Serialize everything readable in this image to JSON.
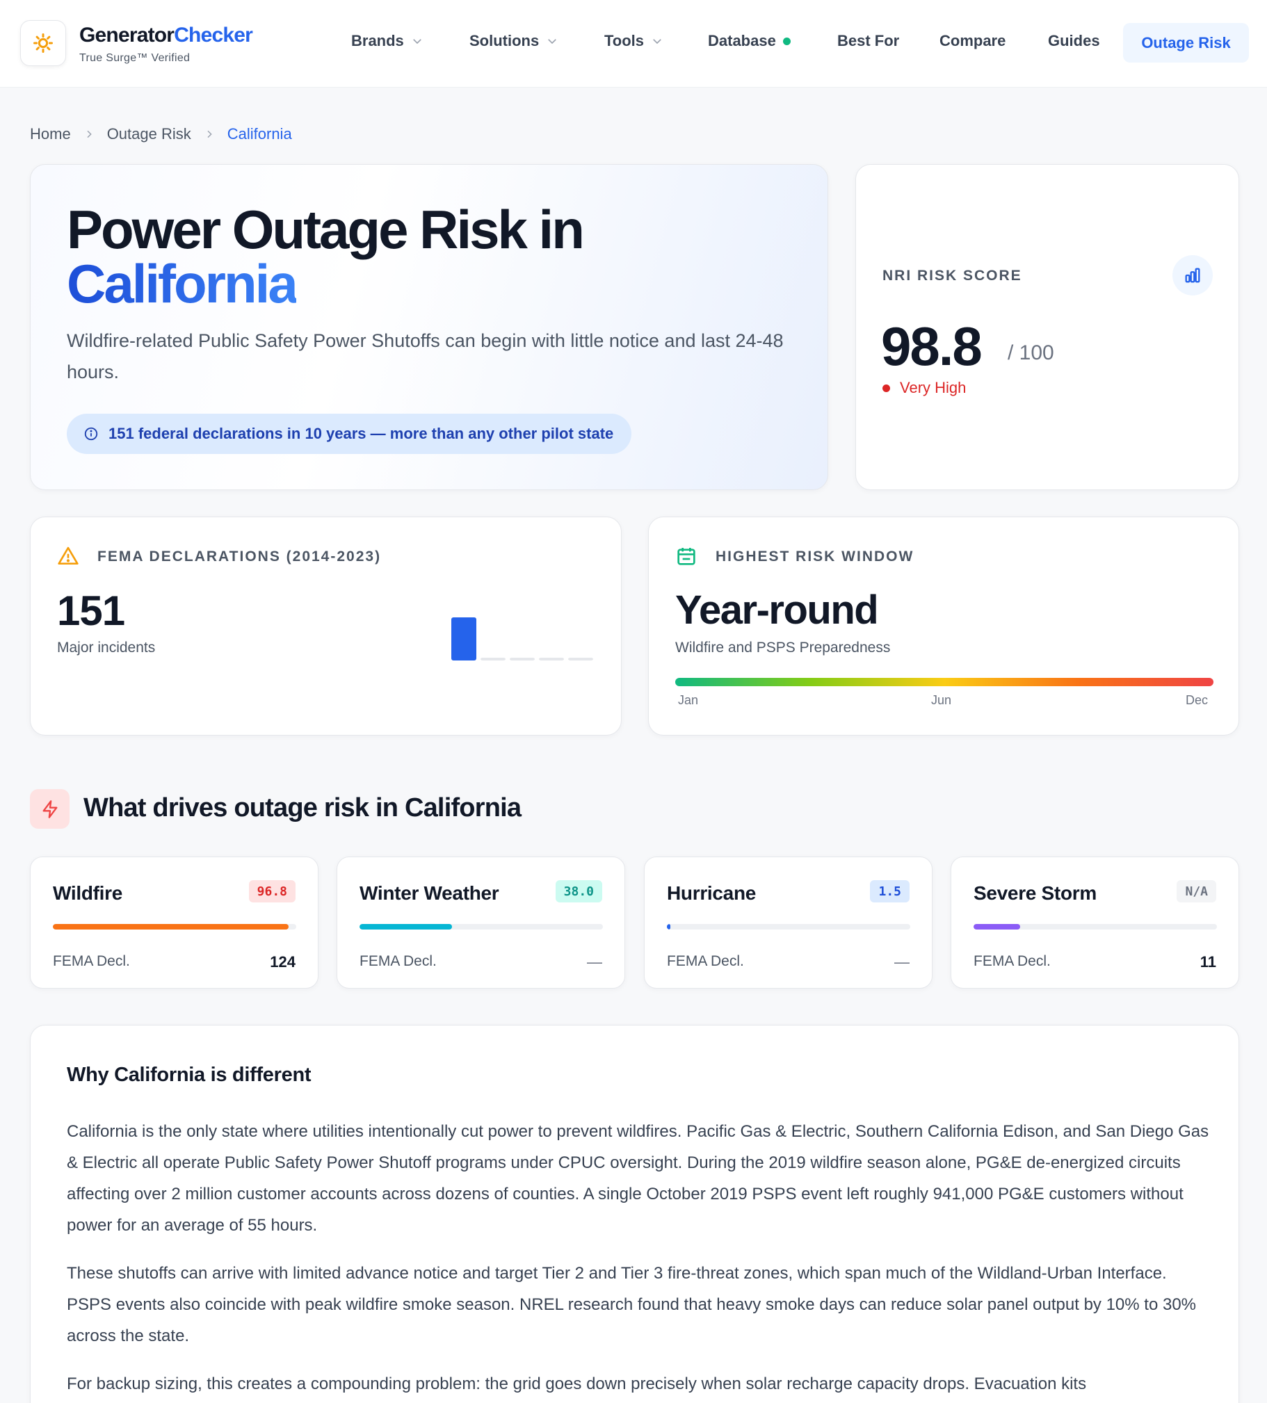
{
  "header": {
    "brand_part1": "Generator",
    "brand_part2": "Checker",
    "tagline": "True Surge™ Verified",
    "logo_icon": "sun-gear-icon",
    "nav": [
      {
        "label": "Brands",
        "dropdown": true
      },
      {
        "label": "Solutions",
        "dropdown": true
      },
      {
        "label": "Tools",
        "dropdown": true
      },
      {
        "label": "Database",
        "status_dot": true
      },
      {
        "label": "Best For"
      },
      {
        "label": "Compare"
      },
      {
        "label": "Guides"
      },
      {
        "label": "Outage Risk",
        "active": true
      }
    ]
  },
  "breadcrumb": [
    "Home",
    "Outage Risk",
    "California"
  ],
  "hero": {
    "title_line1": "Power Outage Risk in",
    "title_line2": "California",
    "subtitle": "Wildfire-related Public Safety Power Shutoffs can begin with little notice and last 24-48 hours.",
    "pill": "151 federal declarations in 10 years — more than any other pilot state"
  },
  "nri": {
    "label": "NRI RISK SCORE",
    "score": "98.8",
    "max": "/ 100",
    "level": "Very High",
    "level_color": "#dc2626"
  },
  "fema": {
    "label": "FEMA DECLARATIONS (2014-2023)",
    "value": "151",
    "sub": "Major incidents",
    "mini_bars": [
      1,
      0,
      0,
      0,
      0
    ]
  },
  "highest_risk": {
    "label": "HIGHEST RISK WINDOW",
    "value": "Year-round",
    "sub": "Wildfire and PSPS Preparedness",
    "months": [
      "Jan",
      "Jun",
      "Dec"
    ]
  },
  "drivers_section": {
    "title": "What drives outage risk in California",
    "icon": "lightning-icon",
    "items": [
      {
        "name": "Wildfire",
        "score": "96.8",
        "level": 0.968,
        "color": "#f97316",
        "badge_bg": "#fee2e2",
        "badge_fg": "#dc2626",
        "fema_label": "FEMA Decl.",
        "fema": "124"
      },
      {
        "name": "Winter Weather",
        "score": "38.0",
        "level": 0.38,
        "color": "#06b6d4",
        "badge_bg": "#ccfbf1",
        "badge_fg": "#0d9488",
        "fema_label": "FEMA Decl.",
        "fema": "—"
      },
      {
        "name": "Hurricane",
        "score": "1.5",
        "level": 0.015,
        "color": "#2563eb",
        "badge_bg": "#dbeafe",
        "badge_fg": "#1d4ed8",
        "fema_label": "FEMA Decl.",
        "fema": "—"
      },
      {
        "name": "Severe Storm",
        "score": "N/A",
        "level": 0.19,
        "color": "#8b5cf6",
        "badge_bg": "#f3f4f6",
        "badge_fg": "#6b7280",
        "fema_label": "FEMA Decl.",
        "fema": "11"
      }
    ]
  },
  "article": {
    "title": "Why California is different",
    "paragraphs": [
      "California is the only state where utilities intentionally cut power to prevent wildfires. Pacific Gas & Electric, Southern California Edison, and San Diego Gas & Electric all operate Public Safety Power Shutoff programs under CPUC oversight. During the 2019 wildfire season alone, PG&E de-energized circuits affecting over 2 million customer accounts across dozens of counties. A single October 2019 PSPS event left roughly 941,000 PG&E customers without power for an average of 55 hours.",
      "These shutoffs can arrive with limited advance notice and target Tier 2 and Tier 3 fire-threat zones, which span much of the Wildland-Urban Interface. PSPS events also coincide with peak wildfire smoke season. NREL research found that heavy smoke days can reduce solar panel output by 10% to 30% across the state.",
      "For backup sizing, this creates a compounding problem: the grid goes down precisely when solar recharge capacity drops. Evacuation kits"
    ]
  }
}
